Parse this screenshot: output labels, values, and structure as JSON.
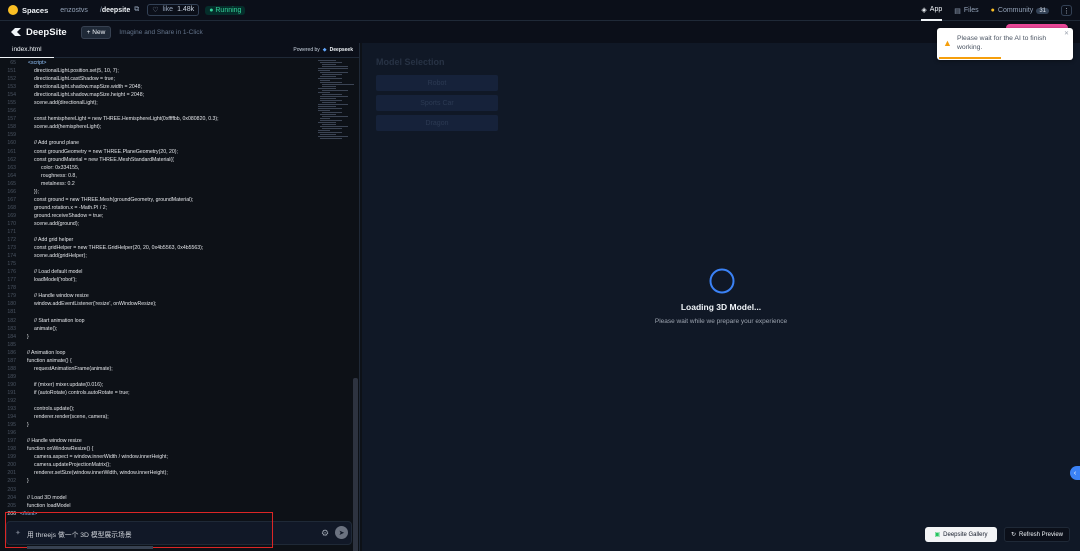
{
  "hf_header": {
    "spaces_label": "Spaces",
    "owner": "enzostvs",
    "separator": "/",
    "repo": "deepsite",
    "like_label": "like",
    "like_count": "1.48k",
    "status": "Running",
    "tabs": [
      {
        "label": "App",
        "active": true
      },
      {
        "label": "Files",
        "active": false
      },
      {
        "label": "Community",
        "badge": "31",
        "active": false
      }
    ]
  },
  "app_header": {
    "title": "DeepSite",
    "new_button": "New",
    "tagline": "Imagine and Share in 1-Click"
  },
  "editor": {
    "tab": "index.html",
    "powered_by": "Powered by",
    "powered_brand": "Deepseek",
    "top_line": {
      "num": "65",
      "text": "<script>"
    },
    "lines": [
      {
        "num": "151",
        "indent": 2,
        "text": "directionalLight.position.set(5, 10, 7);"
      },
      {
        "num": "152",
        "indent": 2,
        "text": "directionalLight.castShadow = true;"
      },
      {
        "num": "153",
        "indent": 2,
        "text": "directionalLight.shadow.mapSize.width = 2048;"
      },
      {
        "num": "154",
        "indent": 2,
        "text": "directionalLight.shadow.mapSize.height = 2048;"
      },
      {
        "num": "155",
        "indent": 2,
        "text": "scene.add(directionalLight);"
      },
      {
        "num": "156",
        "indent": 0,
        "text": ""
      },
      {
        "num": "157",
        "indent": 2,
        "text": "const hemisphereLight = new THREE.HemisphereLight(0xffffbb, 0x080820, 0.3);"
      },
      {
        "num": "158",
        "indent": 2,
        "text": "scene.add(hemisphereLight);"
      },
      {
        "num": "159",
        "indent": 0,
        "text": ""
      },
      {
        "num": "160",
        "indent": 2,
        "text": "// Add ground plane"
      },
      {
        "num": "161",
        "indent": 2,
        "text": "const groundGeometry = new THREE.PlaneGeometry(20, 20);"
      },
      {
        "num": "162",
        "indent": 2,
        "text": "const groundMaterial = new THREE.MeshStandardMaterial({"
      },
      {
        "num": "163",
        "indent": 3,
        "text": "color: 0x334155,"
      },
      {
        "num": "164",
        "indent": 3,
        "text": "roughness: 0.8,"
      },
      {
        "num": "165",
        "indent": 3,
        "text": "metalness: 0.2"
      },
      {
        "num": "166",
        "indent": 2,
        "text": "});"
      },
      {
        "num": "167",
        "indent": 2,
        "text": "const ground = new THREE.Mesh(groundGeometry, groundMaterial);"
      },
      {
        "num": "168",
        "indent": 2,
        "text": "ground.rotation.x = -Math.PI / 2;"
      },
      {
        "num": "169",
        "indent": 2,
        "text": "ground.receiveShadow = true;"
      },
      {
        "num": "170",
        "indent": 2,
        "text": "scene.add(ground);"
      },
      {
        "num": "171",
        "indent": 0,
        "text": ""
      },
      {
        "num": "172",
        "indent": 2,
        "text": "// Add grid helper"
      },
      {
        "num": "173",
        "indent": 2,
        "text": "const gridHelper = new THREE.GridHelper(20, 20, 0x4b5563, 0x4b5563);"
      },
      {
        "num": "174",
        "indent": 2,
        "text": "scene.add(gridHelper);"
      },
      {
        "num": "175",
        "indent": 0,
        "text": ""
      },
      {
        "num": "176",
        "indent": 2,
        "text": "// Load default model"
      },
      {
        "num": "177",
        "indent": 2,
        "text": "loadModel('robot');"
      },
      {
        "num": "178",
        "indent": 0,
        "text": ""
      },
      {
        "num": "179",
        "indent": 2,
        "text": "// Handle window resize"
      },
      {
        "num": "180",
        "indent": 2,
        "text": "window.addEventListener('resize', onWindowResize);"
      },
      {
        "num": "181",
        "indent": 0,
        "text": ""
      },
      {
        "num": "182",
        "indent": 2,
        "text": "// Start animation loop"
      },
      {
        "num": "183",
        "indent": 2,
        "text": "animate();"
      },
      {
        "num": "184",
        "indent": 1,
        "text": "}"
      },
      {
        "num": "185",
        "indent": 0,
        "text": ""
      },
      {
        "num": "186",
        "indent": 1,
        "text": "// Animation loop"
      },
      {
        "num": "187",
        "indent": 1,
        "text": "function animate() {"
      },
      {
        "num": "188",
        "indent": 2,
        "text": "requestAnimationFrame(animate);"
      },
      {
        "num": "189",
        "indent": 0,
        "text": ""
      },
      {
        "num": "190",
        "indent": 2,
        "text": "if (mixer) mixer.update(0.016);"
      },
      {
        "num": "191",
        "indent": 2,
        "text": "if (autoRotate) controls.autoRotate = true;"
      },
      {
        "num": "192",
        "indent": 0,
        "text": ""
      },
      {
        "num": "193",
        "indent": 2,
        "text": "controls.update();"
      },
      {
        "num": "194",
        "indent": 2,
        "text": "renderer.render(scene, camera);"
      },
      {
        "num": "195",
        "indent": 1,
        "text": "}"
      },
      {
        "num": "196",
        "indent": 0,
        "text": ""
      },
      {
        "num": "197",
        "indent": 1,
        "text": "// Handle window resize"
      },
      {
        "num": "198",
        "indent": 1,
        "text": "function onWindowResize() {"
      },
      {
        "num": "199",
        "indent": 2,
        "text": "camera.aspect = window.innerWidth / window.innerHeight;"
      },
      {
        "num": "200",
        "indent": 2,
        "text": "camera.updateProjectionMatrix();"
      },
      {
        "num": "201",
        "indent": 2,
        "text": "renderer.setSize(window.innerWidth, window.innerHeight);"
      },
      {
        "num": "202",
        "indent": 1,
        "text": "}"
      },
      {
        "num": "203",
        "indent": 0,
        "text": ""
      },
      {
        "num": "204",
        "indent": 1,
        "text": "// Load 3D model"
      },
      {
        "num": "205",
        "indent": 1,
        "text": "function loadModel"
      },
      {
        "num": "206",
        "indent": 0,
        "text": "</html>"
      }
    ]
  },
  "prompt": {
    "text": "用 threejs 做一个 3D 模型展示场景"
  },
  "preview": {
    "model_selection_title": "Model Selection",
    "model_buttons": [
      "Robot",
      "Sports Car",
      "Dragon"
    ],
    "loading_title": "Loading 3D Model...",
    "loading_subtitle": "Please wait while we prepare your experience",
    "gallery_button": "Deepsite Gallery",
    "refresh_button": "Refresh Preview"
  },
  "toast": {
    "message": "Please wait for the AI to finish working."
  },
  "colors": {
    "accent_blue": "#3b82f6",
    "warning": "#f59e0b",
    "pink_button": "#ec4899",
    "highlight_red": "#dc2626"
  }
}
